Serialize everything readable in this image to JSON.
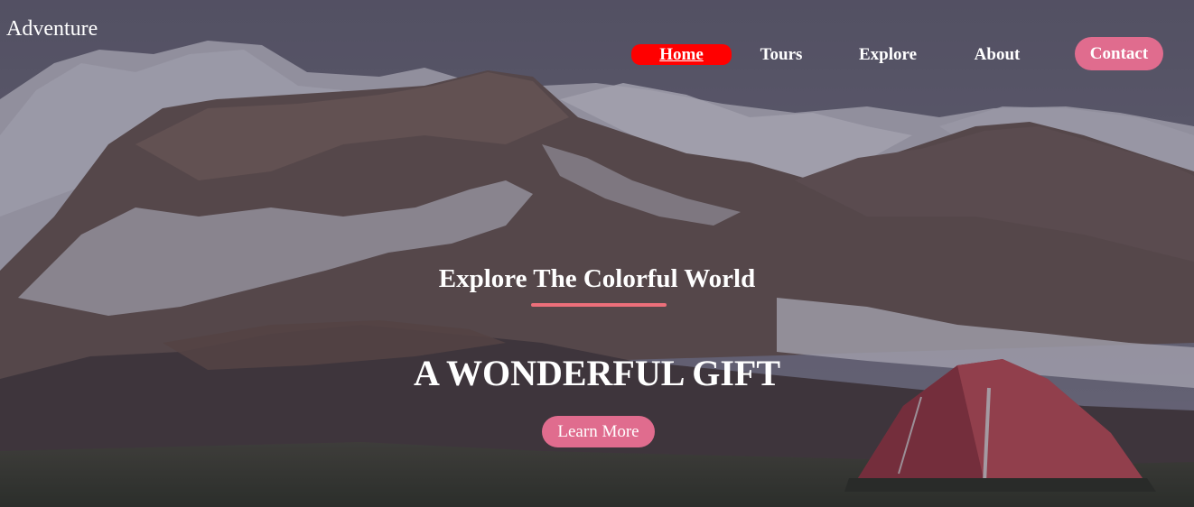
{
  "brand": {
    "name": "Adventure"
  },
  "nav": {
    "items": [
      {
        "label": "Home",
        "active": true
      },
      {
        "label": "Tours"
      },
      {
        "label": "Explore"
      },
      {
        "label": "About"
      },
      {
        "label": "Contact"
      }
    ]
  },
  "hero": {
    "subtitle": "Explore The Colorful World",
    "title": "A WONDERFUL GIFT",
    "cta_label": "Learn More"
  },
  "colors": {
    "active_nav": "#ff0000",
    "accent_pink": "#e06c8e",
    "underline_coral": "#ec6f7a"
  }
}
